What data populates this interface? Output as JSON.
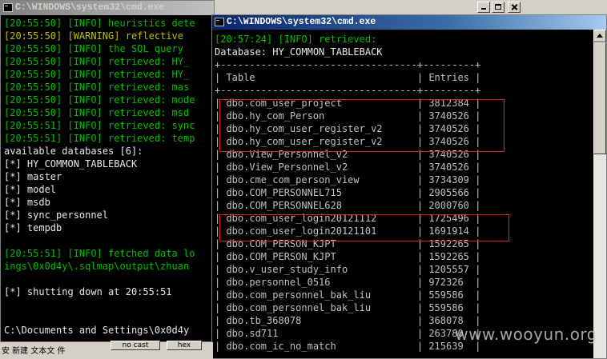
{
  "left_window": {
    "title": "C:\\WINDOWS\\system32\\cmd.exe",
    "log_lines": [
      {
        "text": "[20:55:50] [INFO] heuristics dete",
        "level": "info"
      },
      {
        "text": "[20:55:50] [WARNING] reflective ",
        "level": "warn"
      },
      {
        "text": "[20:55:50] [INFO] the SQL query ",
        "level": "info"
      },
      {
        "text": "[20:55:50] [INFO] retrieved: HY_",
        "level": "info"
      },
      {
        "text": "[20:55:50] [INFO] retrieved: HY_",
        "level": "info"
      },
      {
        "text": "[20:55:50] [INFO] retrieved: mas",
        "level": "info"
      },
      {
        "text": "[20:55:50] [INFO] retrieved: mode",
        "level": "info"
      },
      {
        "text": "[20:55:50] [INFO] retrieved: msd",
        "level": "info"
      },
      {
        "text": "[20:55:51] [INFO] retrieved: sync",
        "level": "info"
      },
      {
        "text": "[20:55:51] [INFO] retrieved: temp",
        "level": "info"
      },
      {
        "text": "available databases [6]:",
        "level": "plain"
      },
      {
        "text": "[*] HY_COMMON_TABLEBACK",
        "level": "plain"
      },
      {
        "text": "[*] master",
        "level": "plain"
      },
      {
        "text": "[*] model",
        "level": "plain"
      },
      {
        "text": "[*] msdb",
        "level": "plain"
      },
      {
        "text": "[*] sync_personnel",
        "level": "plain"
      },
      {
        "text": "[*] tempdb",
        "level": "plain"
      },
      {
        "text": "",
        "level": "plain"
      },
      {
        "text": "[20:55:51] [INFO] fetched data lo",
        "level": "info"
      },
      {
        "text": "ings\\0x0d4y\\.sqlmap\\output\\zhuan",
        "level": "info"
      },
      {
        "text": "",
        "level": "plain"
      },
      {
        "text": "[*] shutting down at 20:55:51",
        "level": "plain"
      },
      {
        "text": "",
        "level": "plain"
      },
      {
        "text": "",
        "level": "plain"
      },
      {
        "text": "C:\\Documents and Settings\\0x0d4y",
        "level": "plain"
      }
    ]
  },
  "right_window": {
    "title": "C:\\WINDOWS\\system32\\cmd.exe",
    "retrieved_line": "[20:57:24] [INFO] retrieved:",
    "database_line": "Database: HY_COMMON_TABLEBACK",
    "table_border": "+----------------------------------+---------+",
    "header": {
      "table": "Table",
      "entries": "Entries"
    },
    "rows": [
      {
        "table": "dbo.com_user_project",
        "entries": "3812384"
      },
      {
        "table": "dbo.hy_com_Person",
        "entries": "3740526"
      },
      {
        "table": "dbo.hy_com_user_register_v2",
        "entries": "3740526"
      },
      {
        "table": "dbo.hy_com_user_register_v2",
        "entries": "3740526"
      },
      {
        "table": "dbo.View_Personnel_v2",
        "entries": "3740526"
      },
      {
        "table": "dbo.View_Personnel_v2",
        "entries": "3740526"
      },
      {
        "table": "dbo.cme_com_person_view",
        "entries": "3734309"
      },
      {
        "table": "dbo.COM_PERSONNEL715",
        "entries": "2905566"
      },
      {
        "table": "dbo.COM_PERSONNEL628",
        "entries": "2000760"
      },
      {
        "table": "dbo.com_user_login20121112",
        "entries": "1725496"
      },
      {
        "table": "dbo.com_user_login20121101",
        "entries": "1691914"
      },
      {
        "table": "dbo.COM_PERSON_KJPT",
        "entries": "1592265"
      },
      {
        "table": "dbo.COM_PERSON_KJPT",
        "entries": "1592265"
      },
      {
        "table": "dbo.v_user_study_info",
        "entries": "1205557"
      },
      {
        "table": "dbo.personnel_0516",
        "entries": "972326"
      },
      {
        "table": "dbo.com_personnel_bak_liu",
        "entries": "559586"
      },
      {
        "table": "dbo.com_personnel_bak_liu",
        "entries": "559586"
      },
      {
        "table": "dbo.tb_368078",
        "entries": "368078"
      },
      {
        "table": "dbo.sd711",
        "entries": "263780"
      },
      {
        "table": "dbo.com_ic_no_match",
        "entries": "215639"
      }
    ]
  },
  "taskbar": {
    "text": "安  新建 文本文 件",
    "status_left": "no cast",
    "status_right": "hex"
  },
  "watermark": "www.wooyun.org",
  "colors": {
    "console_bg": "#000000",
    "info_green": "#00c000",
    "warning_yellow": "#c0c000",
    "console_text": "#c0c0c0",
    "highlight_red": "#e0201e",
    "active_title": "#0a246a"
  }
}
